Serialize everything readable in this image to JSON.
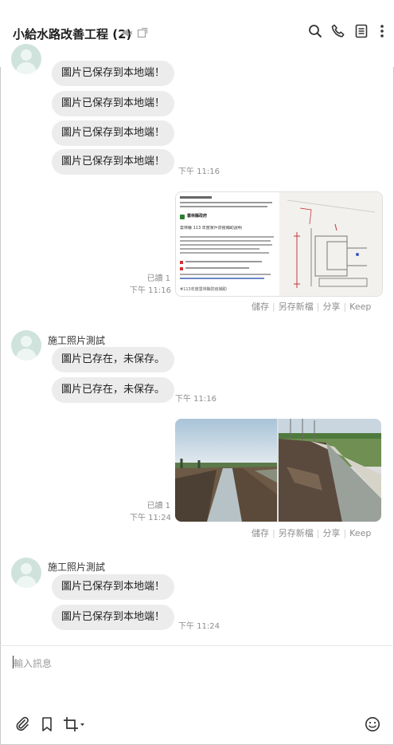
{
  "header": {
    "title": "小給水路改善工程",
    "member_count": "(2)",
    "icons": [
      "mute-icon",
      "external-window-icon",
      "search-icon",
      "phone-icon",
      "notes-icon",
      "more-icon"
    ]
  },
  "messages": {
    "group1": {
      "bubbles": [
        "圖片已保存到本地端！",
        "圖片已保存到本地端！",
        "圖片已保存到本地端！",
        "圖片已保存到本地端！"
      ],
      "time": "下午 11:16"
    },
    "image1": {
      "read": "已讀 1",
      "time": "下午 11:16",
      "actions": [
        "儲存",
        "另存新檔",
        "分享",
        "Keep"
      ],
      "doc_heading": "雲林縣政府",
      "doc_subtitle": "雲林縣 113 年度家戶防疫補助說明",
      "doc_footer": "#113年度雲林縣防疫補助"
    },
    "group2": {
      "sender": "施工照片測試",
      "bubbles": [
        "圖片已存在，未保存。",
        "圖片已存在，未保存。"
      ],
      "time": "下午 11:16"
    },
    "image2": {
      "read": "已讀 1",
      "time": "下午 11:24",
      "actions": [
        "儲存",
        "另存新檔",
        "分享",
        "Keep"
      ]
    },
    "group3": {
      "sender": "施工照片測試",
      "bubbles": [
        "圖片已保存到本地端！",
        "圖片已保存到本地端！"
      ],
      "time": "下午 11:24"
    }
  },
  "compose": {
    "placeholder": "輸入訊息"
  },
  "colors": {
    "bubble": "#ececec",
    "avatar": "#cfe3dc",
    "muted_text": "#8d8d8d"
  }
}
